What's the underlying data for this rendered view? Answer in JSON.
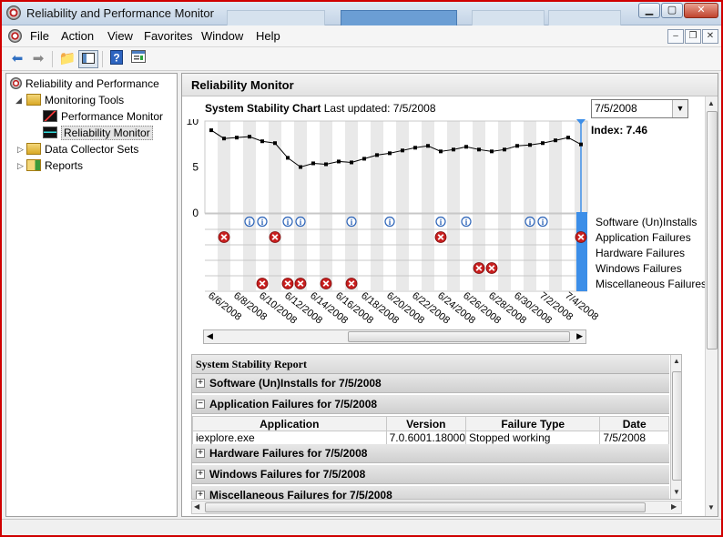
{
  "window": {
    "title": "Reliability and Performance Monitor"
  },
  "menu": {
    "items": [
      "File",
      "Action",
      "View",
      "Favorites",
      "Window",
      "Help"
    ]
  },
  "tree": {
    "root": "Reliability and Performance",
    "monitoring_tools": "Monitoring Tools",
    "performance_monitor": "Performance Monitor",
    "reliability_monitor": "Reliability Monitor",
    "data_collector_sets": "Data Collector Sets",
    "reports": "Reports"
  },
  "panel": {
    "title": "Reliability Monitor",
    "chart_title": "System Stability Chart",
    "last_updated": "Last updated: 7/5/2008",
    "selected_date": "7/5/2008",
    "index_label": "Index: 7.46"
  },
  "chart_data": {
    "type": "line",
    "title": "System Stability Chart",
    "ylim": [
      0,
      10
    ],
    "yticks": [
      "10",
      "5",
      "0"
    ],
    "x_tick_labels": [
      "6/6/2008",
      "6/8/2008",
      "6/10/2008",
      "6/12/2008",
      "6/14/2008",
      "6/16/2008",
      "6/18/2008",
      "6/20/2008",
      "6/22/2008",
      "6/24/2008",
      "6/26/2008",
      "6/28/2008",
      "6/30/2008",
      "7/2/2008",
      "7/4/2008"
    ],
    "series": [
      {
        "values": [
          9.0,
          8.1,
          8.2,
          8.3,
          7.8,
          7.6,
          6.0,
          5.0,
          5.4,
          5.3,
          5.6,
          5.5,
          5.9,
          6.3,
          6.5,
          6.8,
          7.1,
          7.3,
          6.7,
          6.9,
          7.2,
          6.9,
          6.7,
          6.9,
          7.3,
          7.4,
          7.6,
          7.9,
          8.2,
          7.46
        ]
      }
    ],
    "event_rows": [
      "Software (Un)Installs",
      "Application Failures",
      "Hardware Failures",
      "Windows Failures",
      "Miscellaneous Failures"
    ],
    "events": {
      "software_installs": [
        3,
        4,
        6,
        7,
        11,
        14,
        18,
        20,
        25,
        26
      ],
      "application_failures": [
        1,
        5,
        18,
        29
      ],
      "hardware_failures": [],
      "windows_failures": [
        21,
        22
      ],
      "miscellaneous_failures": [
        4,
        6,
        7,
        9,
        11
      ]
    },
    "selected_index": 29,
    "colors": {
      "line": "#000000",
      "selection": "#3c8ee8",
      "failure": "#c81e1e",
      "info": "#2b63b8"
    }
  },
  "report": {
    "title": "System Stability Report",
    "sections": {
      "software": "Software (Un)Installs for 7/5/2008",
      "application": "Application Failures for 7/5/2008",
      "hardware": "Hardware Failures for 7/5/2008",
      "windows": "Windows Failures for 7/5/2008",
      "misc": "Miscellaneous Failures for 7/5/2008"
    },
    "table": {
      "headers": {
        "application": "Application",
        "version": "Version",
        "failure_type": "Failure Type",
        "date": "Date"
      },
      "rows": [
        {
          "application": "iexplore.exe",
          "version": "7.0.6001.18000",
          "failure_type": "Stopped working",
          "date": "7/5/2008"
        }
      ]
    }
  },
  "icons": {
    "back": "back-arrow-icon",
    "forward": "forward-arrow-icon",
    "up": "up-folder-icon",
    "show_hide": "show-hide-tree-icon",
    "help": "help-icon",
    "properties": "properties-icon"
  }
}
